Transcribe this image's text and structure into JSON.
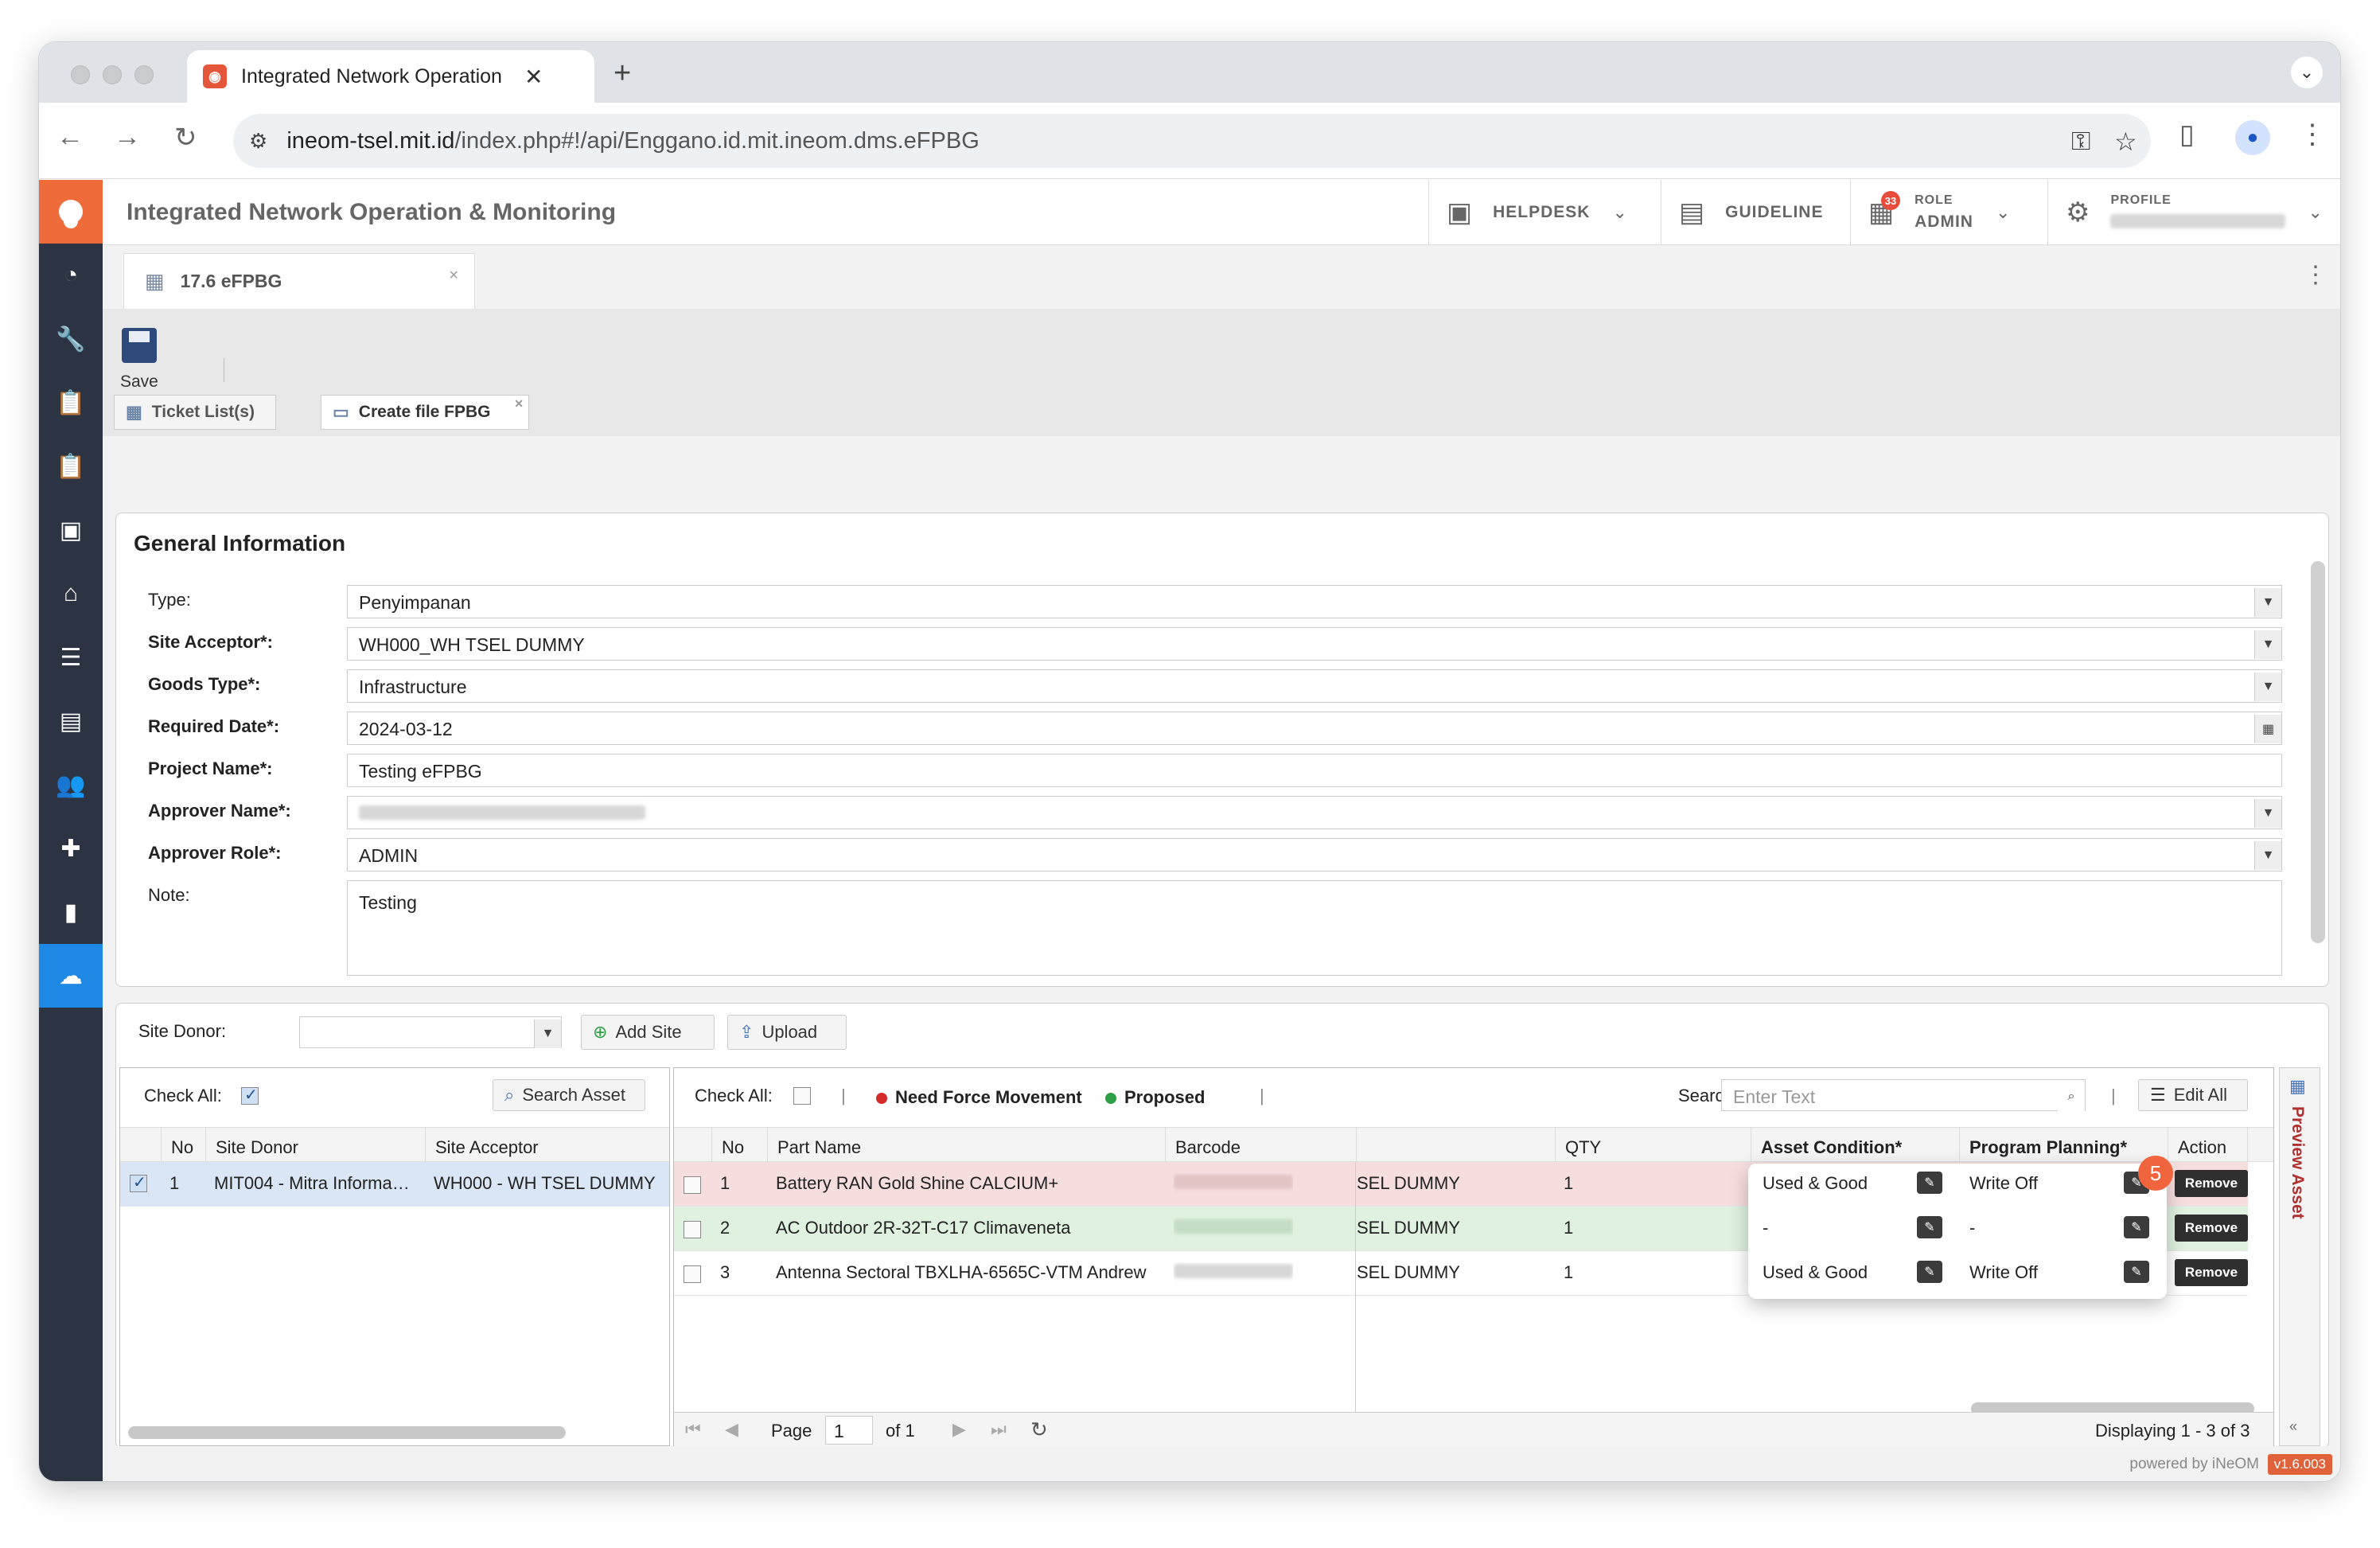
{
  "browser": {
    "tab_title": "Integrated Network Operation",
    "new_tab": "+",
    "url_host": "ineom-tsel.mit.id",
    "url_path": "/index.php#!/api/Enggano.id.mit.ineom.dms.eFPBG"
  },
  "header": {
    "app_title": "Integrated Network Operation & Monitoring",
    "helpdesk": "HELPDESK",
    "guideline": "GUIDELINE",
    "role_caption": "ROLE",
    "role_value": "ADMIN",
    "notif_count": "33",
    "profile_caption": "PROFILE"
  },
  "doc_tab": {
    "label": "17.6 eFPBG",
    "close": "×"
  },
  "toolbar": {
    "save_label": "Save"
  },
  "sub_tabs": [
    {
      "label": "Ticket List(s)"
    },
    {
      "label": "Create file FPBG"
    }
  ],
  "general": {
    "title": "General Information",
    "fields": [
      {
        "label": "Type:",
        "value": "Penyimpanan"
      },
      {
        "label": "Site Acceptor*:",
        "value": "WH000_WH TSEL DUMMY"
      },
      {
        "label": "Goods Type*:",
        "value": "Infrastructure"
      },
      {
        "label": "Required Date*:",
        "value": "2024-03-12"
      },
      {
        "label": "Project Name*:",
        "value": "Testing eFPBG"
      },
      {
        "label": "Approver Name*:",
        "value": ""
      },
      {
        "label": "Approver Role*:",
        "value": "ADMIN"
      },
      {
        "label": "Note:",
        "value": "Testing"
      }
    ]
  },
  "site": {
    "donor_label": "Site Donor:",
    "add_site": "Add Site",
    "upload": "Upload",
    "check_all": "Check All:",
    "search_asset": "Search Asset",
    "columns": [
      "No",
      "Site Donor",
      "Site Acceptor"
    ],
    "rows": [
      {
        "no": "1",
        "donor": "MIT004 - Mitra Informa…",
        "acceptor": "WH000 - WH TSEL DUMMY"
      }
    ]
  },
  "assets": {
    "check_all": "Check All:",
    "legend_force": "Need Force Movement",
    "legend_proposed": "Proposed",
    "search_label": "Search:",
    "search_placeholder": "Enter Text",
    "edit_all": "Edit All",
    "columns": [
      "No",
      "Part Name",
      "Barcode",
      "",
      "QTY",
      "Asset Condition*",
      "Program Planning*",
      "Action"
    ],
    "rows": [
      {
        "no": "1",
        "part": "Battery RAN Gold Shine CALCIUM+",
        "site": "SEL DUMMY",
        "qty": "1",
        "condition": "Used & Good",
        "planning": "Write Off",
        "action": "Remove"
      },
      {
        "no": "2",
        "part": "AC Outdoor 2R-32T-C17 Climaveneta",
        "site": "SEL DUMMY",
        "qty": "1",
        "condition": "-",
        "planning": "-",
        "action": "Remove"
      },
      {
        "no": "3",
        "part": "Antenna Sectoral TBXLHA-6565C-VTM Andrew",
        "site": "SEL DUMMY",
        "qty": "1",
        "condition": "Used & Good",
        "planning": "Write Off",
        "action": "Remove"
      }
    ],
    "step_badge": "5",
    "pager_page": "Page",
    "pager_value": "1",
    "pager_of": "of 1",
    "displaying": "Displaying 1 - 3 of 3",
    "preview": "Preview Asset"
  },
  "footer": {
    "powered": "powered by iNeOM",
    "version": "v1.6.003"
  },
  "colors": {
    "accent": "#f06b3a",
    "sidebar": "#2c3443",
    "active": "#1e88e5",
    "row_red": "#f6dede",
    "row_green": "#dff1df"
  }
}
